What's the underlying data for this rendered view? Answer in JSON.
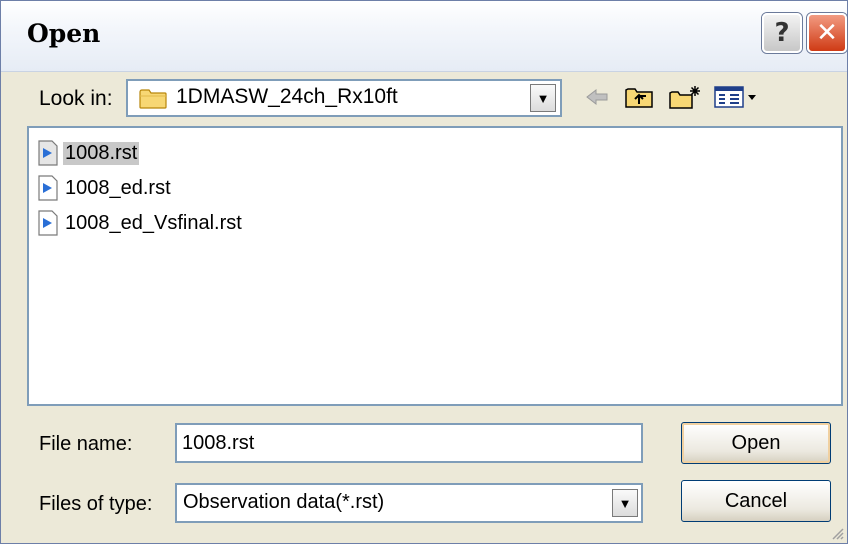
{
  "window": {
    "title": "Open"
  },
  "titlebar_buttons": {
    "help_label": "?",
    "close_label": "✕"
  },
  "look_in": {
    "label": "Look in:",
    "value": "1DMASW_24ch_Rx10ft",
    "icon": "folder-icon"
  },
  "toolbar": {
    "icons": [
      "back-arrow-icon",
      "up-folder-icon",
      "new-folder-icon",
      "views-menu-icon"
    ]
  },
  "files": [
    {
      "name": "1008.rst",
      "selected": true
    },
    {
      "name": "1008_ed.rst",
      "selected": false
    },
    {
      "name": "1008_ed_Vsfinal.rst",
      "selected": false
    }
  ],
  "file_name": {
    "label": "File name:",
    "value": "1008.rst"
  },
  "file_type": {
    "label": "Files of type:",
    "value": "Observation data(*.rst)"
  },
  "buttons": {
    "open_label": "Open",
    "cancel_label": "Cancel"
  },
  "colors": {
    "dialog_bg": "#ece9d8",
    "close_button": "#cf3a14",
    "selection": "#c8c8c8",
    "field_border": "#7f9db9"
  }
}
